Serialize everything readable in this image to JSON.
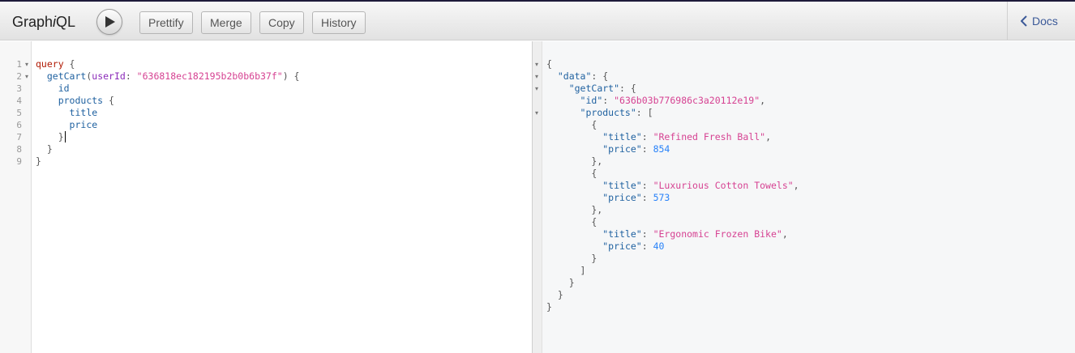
{
  "app": {
    "title_prefix": "Graph",
    "title_i": "i",
    "title_suffix": "QL"
  },
  "toolbar": {
    "run_icon": "play-icon",
    "buttons": [
      "Prettify",
      "Merge",
      "Copy",
      "History"
    ]
  },
  "docs": {
    "label": "Docs",
    "icon": "chevron-left-icon"
  },
  "editor": {
    "line_numbers": [
      "1",
      "2",
      "3",
      "4",
      "5",
      "6",
      "7",
      "8",
      "9"
    ],
    "fold_marker": "▾",
    "lines": [
      [
        "query",
        " {"
      ],
      [
        "  ",
        "getCart",
        "(",
        "userId",
        ": ",
        "\"636818ec182195b2b0b6b37f\"",
        ") {"
      ],
      [
        "    ",
        "id"
      ],
      [
        "    ",
        "products",
        " {"
      ],
      [
        "      ",
        "title"
      ],
      [
        "      ",
        "price"
      ],
      [
        "    ",
        "}"
      ],
      [
        "  ",
        "}"
      ],
      [
        "}"
      ]
    ]
  },
  "result": {
    "lines": [
      "{",
      "  \"data\": {",
      "    \"getCart\": {",
      "      \"id\": \"636b03b776986c3a20112e19\",",
      "      \"products\": [",
      "        {",
      "          \"title\": \"Refined Fresh Ball\",",
      "          \"price\": 854",
      "        },",
      "        {",
      "          \"title\": \"Luxurious Cotton Towels\",",
      "          \"price\": 573",
      "        },",
      "        {",
      "          \"title\": \"Ergonomic Frozen Bike\",",
      "          \"price\": 40",
      "        }",
      "      ]",
      "    }",
      "  }",
      "}"
    ],
    "fold_lines": [
      0,
      1,
      2,
      4
    ]
  },
  "colors": {
    "keyword": "#b11a04",
    "field": "#1f61a0",
    "string": "#d64292",
    "number": "#2882f9"
  }
}
